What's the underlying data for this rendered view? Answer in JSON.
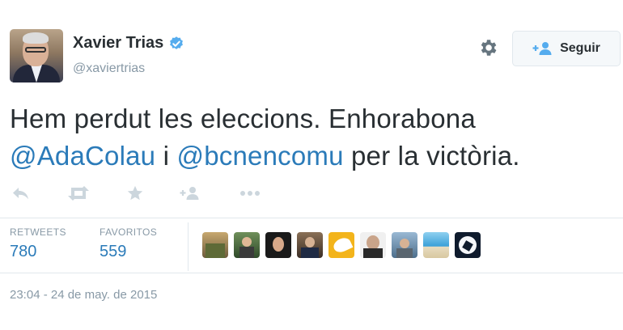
{
  "user": {
    "name": "Xavier Trias",
    "handle": "@xaviertrias",
    "verified": true
  },
  "follow_button": {
    "label": "Seguir"
  },
  "tweet": {
    "line1": "Hem perdut les eleccions. Enhorabona",
    "mention1": "@AdaColau",
    "conj": " i ",
    "mention2": "@bcnencomu",
    "line2_tail": " per la victòria."
  },
  "actions": [
    "reply-icon",
    "retweet-icon",
    "favorite-icon",
    "follow-icon",
    "more-icon"
  ],
  "stats": {
    "retweets_label": "RETWEETS",
    "retweets_value": "780",
    "favorites_label": "FAVORITOS",
    "favorites_value": "559"
  },
  "timestamp": "23:04 - 24 de may. de 2015",
  "colors": {
    "link": "#2b7bb9",
    "muted": "#8899a6",
    "text": "#292f33",
    "verified": "#55acee"
  }
}
